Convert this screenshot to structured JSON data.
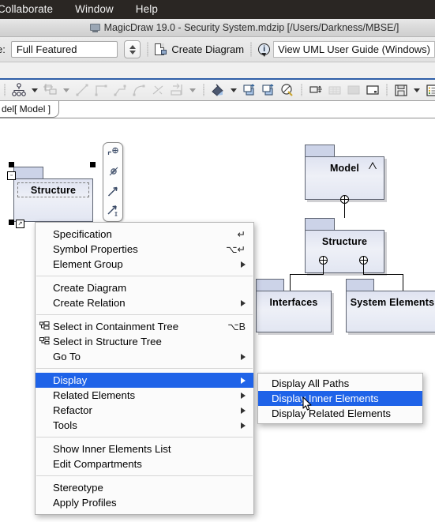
{
  "menubar": {
    "items": [
      {
        "label": "Collaborate"
      },
      {
        "label": "Window"
      },
      {
        "label": "Help"
      }
    ]
  },
  "titlebar": {
    "title": "MagicDraw 19.0 - Security System.mdzip [/Users/Darkness/MBSE/]",
    "icon": "window-icon"
  },
  "toolbar": {
    "perspective_label": "e:",
    "perspective_value": "Full Featured",
    "stepper_icon": "up-down-stepper-icon",
    "create_diagram_label": "Create Diagram",
    "create_diagram_icon": "create-diagram-icon",
    "info_icon": "info-icon",
    "view_guide_label": "View UML User Guide (Windows)"
  },
  "icon_strip": {
    "icons": [
      "hierarchy-tree-icon",
      "dropdown-caret-icon",
      "nested-element-icon",
      "dropdown-caret-icon",
      "line-path-icon",
      "rectilinear-path-icon",
      "oblique-path-icon",
      "arc-path-icon",
      "bezier-path-icon",
      "reverse-direction-icon",
      "dropdown-caret-icon",
      "fill-color-icon",
      "dropdown-caret-icon",
      "bring-to-front-icon",
      "send-to-back-icon",
      "format-painter-icon",
      "align-icon",
      "grid-icon",
      "fit-icon",
      "presentation-icon",
      "save-layout-icon",
      "dropdown-caret-icon",
      "list-view-icon",
      "dropdown-caret-icon"
    ]
  },
  "diagram_tab": {
    "label": "del[ Model ]"
  },
  "canvas": {
    "selected_shape": {
      "name": "Structure",
      "handles": 4,
      "inner_icon": "text-edit-icon",
      "corner_icon": "resize-icon"
    },
    "smart_manipulator": {
      "icons": [
        "create-nested-package-icon",
        "create-package-icon",
        "create-relation-icon",
        "create-directed-relation-icon"
      ]
    },
    "packages": [
      {
        "name": "Model",
        "has_tag": true
      },
      {
        "name": "Structure",
        "has_tag": false
      },
      {
        "name": "Interfaces",
        "has_tag": false
      },
      {
        "name": "System Elements",
        "has_tag": false
      }
    ]
  },
  "context_menu": {
    "groups": [
      {
        "items": [
          {
            "label": "Specification",
            "accel": "↵",
            "arrow": false,
            "icon": null
          },
          {
            "label": "Symbol Properties",
            "accel": "⌥↵",
            "arrow": false,
            "icon": null
          },
          {
            "label": "Element Group",
            "accel": "",
            "arrow": true,
            "icon": null
          }
        ]
      },
      {
        "items": [
          {
            "label": "Create Diagram",
            "accel": "",
            "arrow": false,
            "icon": null
          },
          {
            "label": "Create Relation",
            "accel": "",
            "arrow": true,
            "icon": null
          }
        ]
      },
      {
        "items": [
          {
            "label": "Select in Containment Tree",
            "accel": "⌥B",
            "arrow": false,
            "icon": "containment-tree-icon"
          },
          {
            "label": "Select in Structure Tree",
            "accel": "",
            "arrow": false,
            "icon": "structure-tree-icon"
          },
          {
            "label": "Go To",
            "accel": "",
            "arrow": true,
            "icon": null
          }
        ]
      },
      {
        "items": [
          {
            "label": "Display",
            "accel": "",
            "arrow": true,
            "icon": null,
            "selected": true
          },
          {
            "label": "Related Elements",
            "accel": "",
            "arrow": true,
            "icon": null
          },
          {
            "label": "Refactor",
            "accel": "",
            "arrow": true,
            "icon": null
          },
          {
            "label": "Tools",
            "accel": "",
            "arrow": true,
            "icon": null
          }
        ]
      },
      {
        "items": [
          {
            "label": "Show Inner Elements List",
            "accel": "",
            "arrow": false,
            "icon": null
          },
          {
            "label": "Edit Compartments",
            "accel": "",
            "arrow": false,
            "icon": null
          }
        ]
      },
      {
        "items": [
          {
            "label": "Stereotype",
            "accel": "",
            "arrow": false,
            "icon": null
          },
          {
            "label": "Apply Profiles",
            "accel": "",
            "arrow": false,
            "icon": null
          }
        ]
      }
    ]
  },
  "submenu": {
    "items": [
      {
        "label": "Display All Paths",
        "selected": false
      },
      {
        "label": "Display Inner Elements",
        "selected": true
      },
      {
        "label": "Display Related Elements",
        "selected": false
      }
    ]
  },
  "colors": {
    "menubar_bg": "#2a2623",
    "selection_blue": "#1f63e8",
    "package_fill": "#e4e8f4",
    "package_tab": "#ccd3e8",
    "package_border": "#5e6472",
    "toolbar_accent": "#2f5fa8"
  }
}
